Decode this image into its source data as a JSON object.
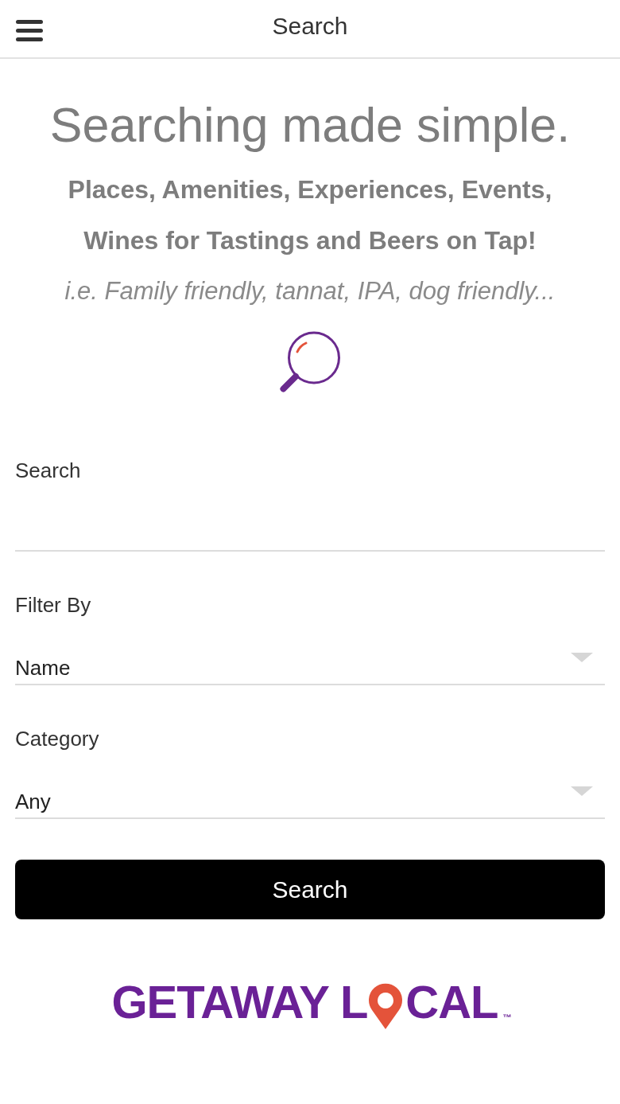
{
  "header": {
    "title": "Search"
  },
  "hero": {
    "heading": "Searching made simple.",
    "lines": [
      "Places, Amenities, Experiences, Events,",
      "Wines for Tastings and Beers on Tap!"
    ],
    "hint": "i.e. Family friendly, tannat, IPA, dog friendly..."
  },
  "form": {
    "fields": [
      {
        "kind": "text",
        "label": "Search"
      },
      {
        "kind": "select",
        "label": "Filter By",
        "value": "Name"
      },
      {
        "kind": "select",
        "label": "Category",
        "value": "Any"
      }
    ],
    "button": "Search"
  },
  "logo": {
    "before_pin": "GETAWAY L",
    "after_pin": "CAL",
    "mark": "™"
  }
}
